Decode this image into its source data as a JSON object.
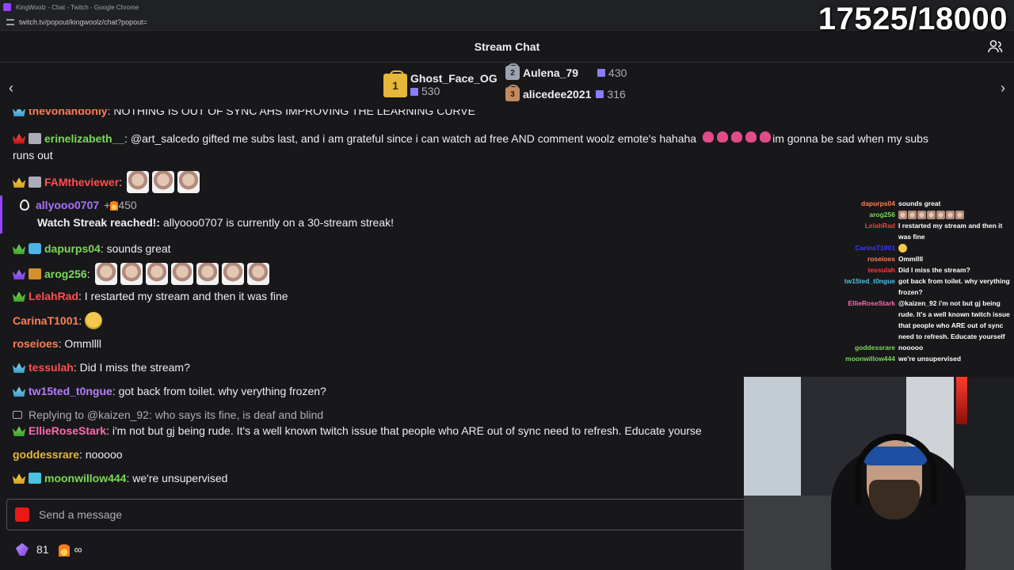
{
  "browser": {
    "window_title": "KingWoolz - Chat - Twitch - Google Chrome",
    "url": "twitch.tv/popout/kingwoolz/chat?popout="
  },
  "overlay_counter": "17525/18000",
  "chat": {
    "header_title": "Stream Chat",
    "leaderboard": [
      {
        "rank": "1",
        "name": "Ghost_Face_OG",
        "count": "530"
      },
      {
        "rank": "2",
        "name": "Aulena_79",
        "count": "430"
      },
      {
        "rank": "3",
        "name": "alicedee2021",
        "count": "316"
      }
    ],
    "cut_line": {
      "user": "thevonandonly",
      "message": ": NOTHING IS OUT OF SYNC AHS IMPROVING THE LEARNING CURVE"
    },
    "messages": [
      {
        "user": "erinelizabeth__",
        "color": "#7cd85a",
        "message": ": @art_salcedo gifted me subs last, and i am grateful since i can watch ad free AND comment woolz emote's hahaha",
        "message2": " im gonna be sad when my subs",
        "message3": "runs out"
      },
      {
        "user": "FAMtheviewer",
        "color": "#ff4f4f",
        "message": ":"
      },
      {
        "user": "dapurps04",
        "color": "#7cd85a",
        "message": ": sounds great"
      },
      {
        "user": "arog256",
        "color": "#7cd85a",
        "message": ":"
      },
      {
        "user": "LelahRad",
        "color": "#ff4f4f",
        "message": ": I restarted my stream and then it was fine"
      },
      {
        "user": "CarinaT1001",
        "color": "#ff7f50",
        "message": ":"
      },
      {
        "user": "roseioes",
        "color": "#ff7f50",
        "message": ": Ommllll"
      },
      {
        "user": "tessulah",
        "color": "#ff4f4f",
        "message": ": Did I miss the stream?"
      },
      {
        "user": "tw15ted_t0ngue",
        "color": "#b77dff",
        "message": ": got back from toilet. why verything frozen?"
      },
      {
        "user": "EllieRoseStark",
        "color": "#ff69b4",
        "message": ": i'm not but gj being rude. It's a well known twitch issue that people who ARE out of sync need to refresh. Educate yourse"
      },
      {
        "user": "goddessrare",
        "color": "#e6b73b",
        "message": ": nooooo"
      },
      {
        "user": "moonwillow444",
        "color": "#7cd85a",
        "message": ": we're unsupervised"
      }
    ],
    "streak": {
      "user": "allyooo0707",
      "points": "+",
      "points_value": "450",
      "label": "Watch Streak reached!:",
      "text": " allyooo0707 is currently on a 30-stream streak!"
    },
    "reply_hint": "Replying to @kaizen_92: who says its fine, is deaf and blind",
    "input_placeholder": "Send a message",
    "bits_count": "81",
    "infinity": "∞"
  },
  "overlay_chat": [
    {
      "name": "dapurps04",
      "color": "#ff7f50",
      "msg": "sounds great"
    },
    {
      "name": "arog256",
      "color": "#7cd85a",
      "msg": ""
    },
    {
      "name": "LelahRad",
      "color": "#ff3b3b",
      "msg": "I restarted my stream and then it was fine"
    },
    {
      "name": "CarinaT1001",
      "color": "#3a3aff",
      "msg": ""
    },
    {
      "name": "roseioes",
      "color": "#ff7f50",
      "msg": "Ommllll"
    },
    {
      "name": "tessulah",
      "color": "#ff3b3b",
      "msg": "Did I miss the stream?"
    },
    {
      "name": "tw15ted_t0ngue",
      "color": "#4cc3e0",
      "msg": "got back from toilet. why verything frozen?"
    },
    {
      "name": "EllieRoseStark",
      "color": "#ff69b4",
      "msg": "@kaizen_92 i'm not but gj being rude. It's a well known twitch issue that people who ARE out of sync need to refresh. Educate yourself"
    },
    {
      "name": "goddessrare",
      "color": "#7cd85a",
      "msg": "nooooo"
    },
    {
      "name": "moonwillow444",
      "color": "#7cd85a",
      "msg": "we're unsupervised"
    }
  ],
  "icons": {
    "prev": "chevron-left-icon",
    "next": "chevron-right-icon",
    "users": "community-icon",
    "camera": "camera-icon",
    "bits": "bits-icon",
    "flame": "flame-icon"
  }
}
